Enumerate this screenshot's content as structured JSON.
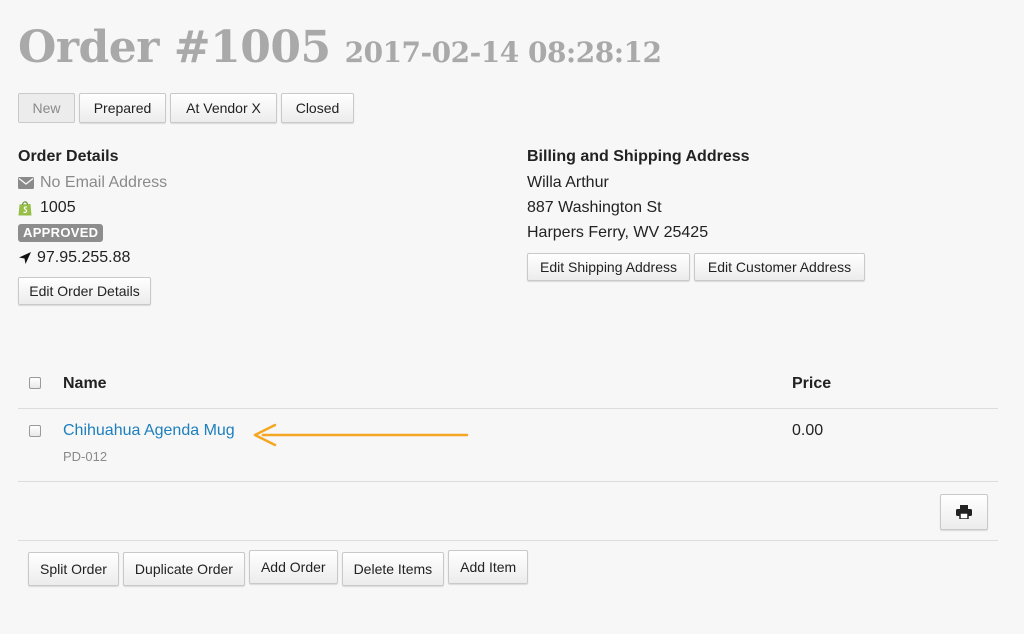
{
  "header": {
    "title": "Order #1005",
    "date": "2017-02-14 08:28:12"
  },
  "status_buttons": [
    "New",
    "Prepared",
    "At Vendor X",
    "Closed"
  ],
  "active_status": "New",
  "order_details": {
    "heading": "Order Details",
    "email": "No Email Address",
    "order_number": "1005",
    "status_badge": "APPROVED",
    "ip": "97.95.255.88",
    "edit_button": "Edit Order Details"
  },
  "address": {
    "heading": "Billing and Shipping Address",
    "name": "Willa Arthur",
    "street": "887 Washington St",
    "city_state_zip": "Harpers Ferry, WV 25425",
    "edit_shipping_button": "Edit Shipping Address",
    "edit_customer_button": "Edit Customer Address"
  },
  "items_table": {
    "columns": [
      "Name",
      "Price"
    ],
    "rows": [
      {
        "name": "Chihuahua Agenda Mug",
        "sku": "PD-012",
        "price": "0.00"
      }
    ]
  },
  "icons": {
    "email": "envelope-icon",
    "store": "shopify-bag-icon",
    "location": "location-arrow-icon",
    "print": "printer-icon"
  },
  "colors": {
    "link": "#1e7fbd",
    "arrow": "#f5a623",
    "badge": "#8d8d8d",
    "title": "#a9a9a9"
  },
  "actions": [
    "Split Order",
    "Duplicate Order",
    "Add Order",
    "Delete Items",
    "Add Item"
  ]
}
